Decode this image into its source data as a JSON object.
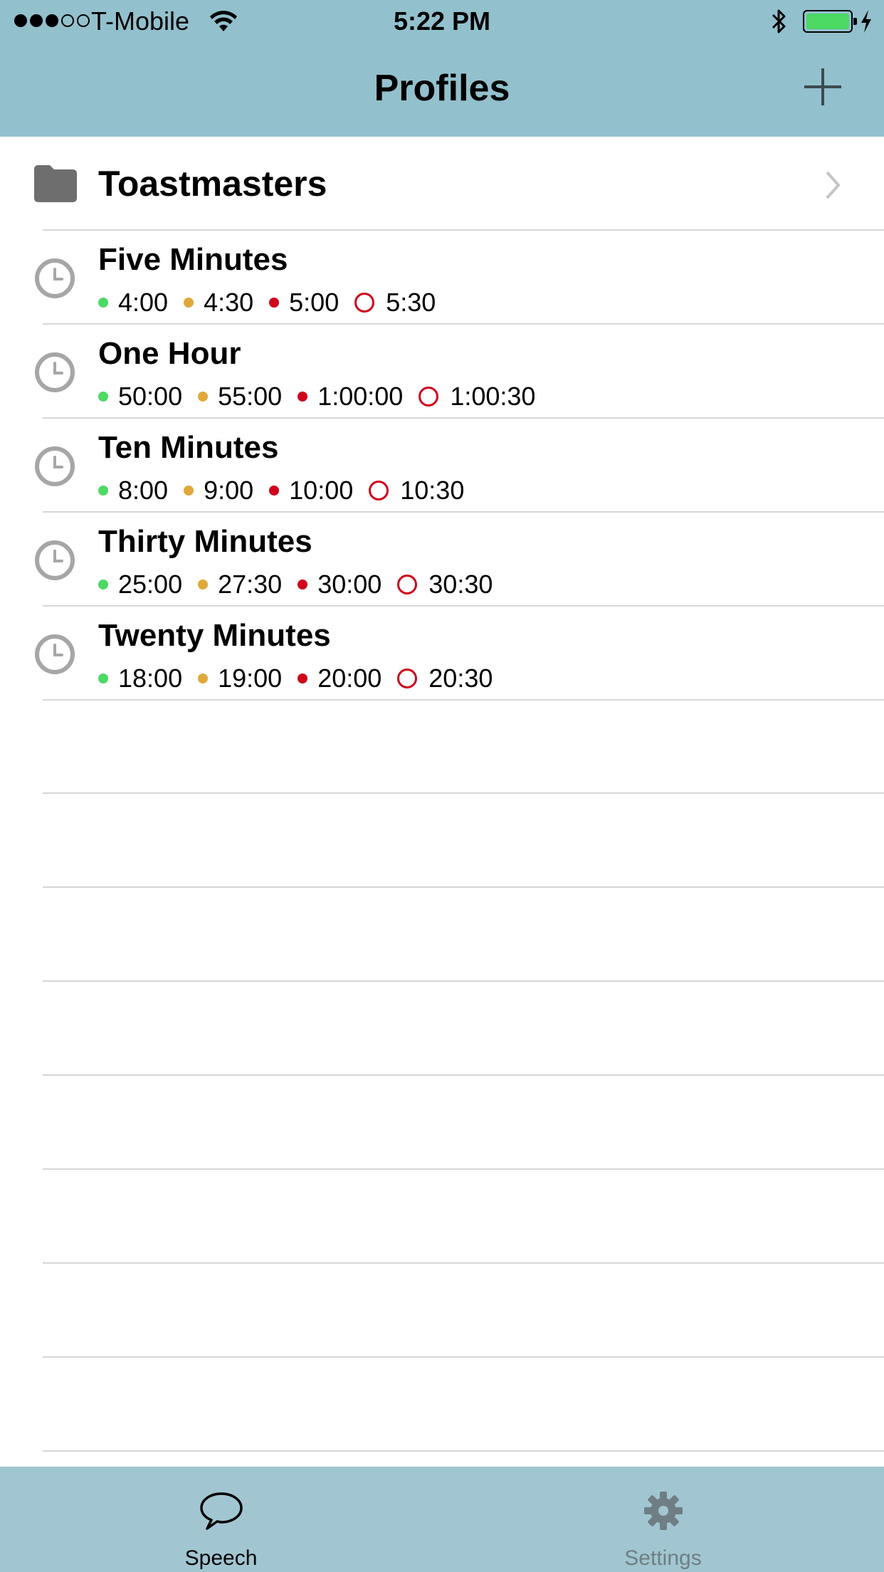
{
  "status_bar": {
    "signal": [
      true,
      true,
      true,
      false,
      false
    ],
    "carrier": "T-Mobile",
    "time": "5:22 PM",
    "battery_color": "#4cd964"
  },
  "nav": {
    "title": "Profiles",
    "add_icon": "plus-icon"
  },
  "folder": {
    "label": "Toastmasters",
    "icon": "folder-icon"
  },
  "profiles": [
    {
      "name": "Five Minutes",
      "times": [
        "4:00",
        "4:30",
        "5:00",
        "5:30"
      ]
    },
    {
      "name": "One Hour",
      "times": [
        "50:00",
        "55:00",
        "1:00:00",
        "1:00:30"
      ]
    },
    {
      "name": "Ten Minutes",
      "times": [
        "8:00",
        "9:00",
        "10:00",
        "10:30"
      ]
    },
    {
      "name": "Thirty Minutes",
      "times": [
        "25:00",
        "27:30",
        "30:00",
        "30:30"
      ]
    },
    {
      "name": "Twenty Minutes",
      "times": [
        "18:00",
        "19:00",
        "20:00",
        "20:30"
      ]
    }
  ],
  "marker_colors": {
    "green": "#4cd964",
    "yellow": "#e0a83a",
    "red": "#d0021b"
  },
  "tabs": [
    {
      "label": "Speech",
      "icon": "speech-bubble-icon",
      "selected": true
    },
    {
      "label": "Settings",
      "icon": "gear-icon",
      "selected": false
    }
  ]
}
